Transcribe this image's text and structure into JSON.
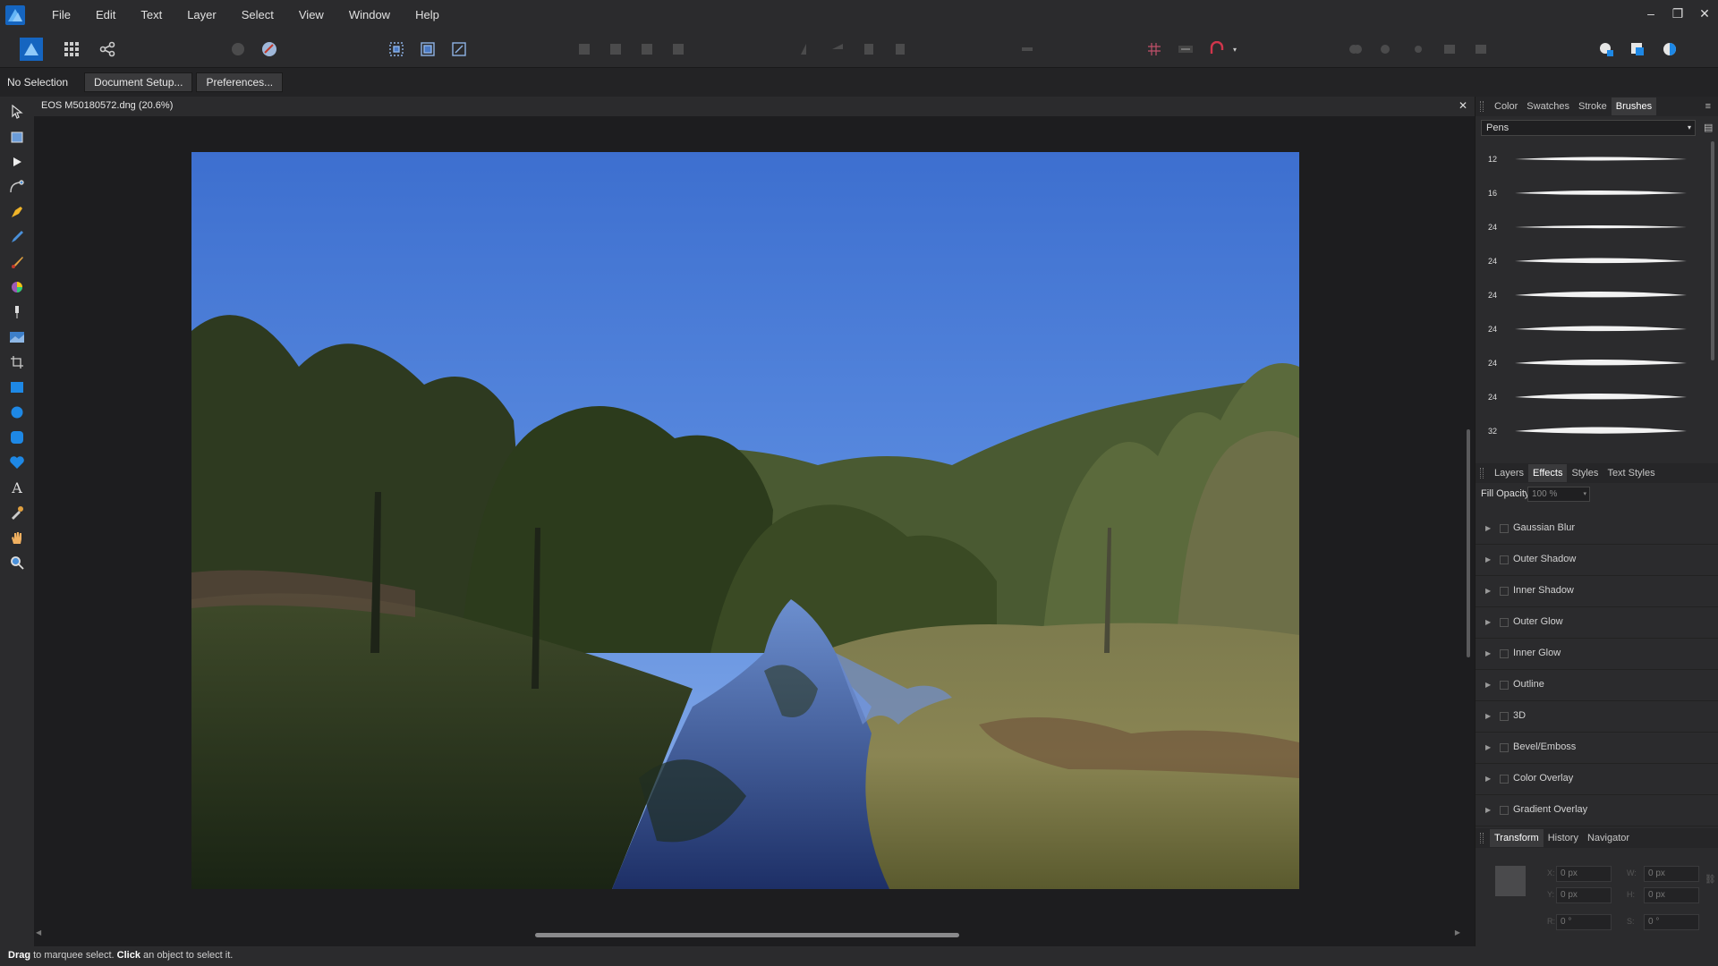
{
  "menu": {
    "items": [
      "File",
      "Edit",
      "Text",
      "Layer",
      "Select",
      "View",
      "Window",
      "Help"
    ]
  },
  "context": {
    "selection": "No Selection",
    "document_setup": "Document Setup...",
    "preferences": "Preferences..."
  },
  "document": {
    "tab_title": "EOS M50180572.dng (20.6%)"
  },
  "brushes_panel": {
    "tabs": [
      "Color",
      "Swatches",
      "Stroke",
      "Brushes"
    ],
    "active_tab": "Brushes",
    "category": "Pens",
    "brush_sizes": [
      "12",
      "16",
      "24",
      "24",
      "24",
      "24",
      "24",
      "24",
      "32"
    ]
  },
  "effects_panel": {
    "tabs": [
      "Layers",
      "Effects",
      "Styles",
      "Text Styles"
    ],
    "active_tab": "Effects",
    "fill_opacity_label": "Fill Opacity:",
    "fill_opacity_value": "100 %",
    "effects": [
      "Gaussian Blur",
      "Outer Shadow",
      "Inner Shadow",
      "Outer Glow",
      "Inner Glow",
      "Outline",
      "3D",
      "Bevel/Emboss",
      "Color Overlay",
      "Gradient Overlay"
    ]
  },
  "transform_panel": {
    "tabs": [
      "Transform",
      "History",
      "Navigator"
    ],
    "active_tab": "Transform",
    "x": "0 px",
    "y": "0 px",
    "w": "0 px",
    "h": "0 px",
    "rotation": "0 °",
    "shear": "0 °",
    "labels": {
      "x": "X:",
      "y": "Y:",
      "w": "W:",
      "h": "H:",
      "r": "R:",
      "s": "S:"
    }
  },
  "status": {
    "drag": "Drag",
    "drag_text": " to marquee select. ",
    "click": "Click",
    "click_text": " an object to select it."
  },
  "colors": {
    "accent": "#1e88e5",
    "panel_bg": "#2b2b2d",
    "app_bg": "#1d1d1f"
  }
}
